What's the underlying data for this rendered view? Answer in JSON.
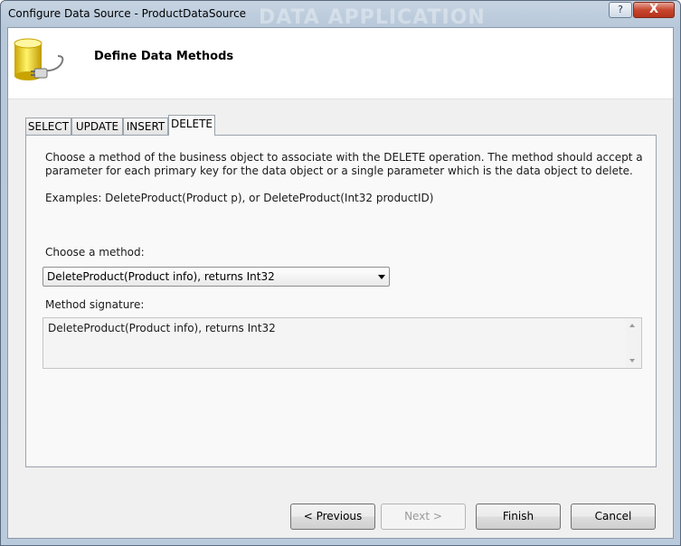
{
  "window": {
    "title": "Configure Data Source - ProductDataSource",
    "watermark": "DATA APPLICATION",
    "help_label": "?",
    "close_label": "X"
  },
  "header": {
    "title": "Define Data Methods",
    "icon": "database-plug-icon"
  },
  "tabs": [
    {
      "label": "SELECT",
      "active": false
    },
    {
      "label": "UPDATE",
      "active": false
    },
    {
      "label": "INSERT",
      "active": false
    },
    {
      "label": "DELETE",
      "active": true
    }
  ],
  "panel": {
    "description": "Choose a method of the business object to associate with the DELETE operation. The method should accept a parameter for each primary key for the data object or a single parameter which is the data object to delete.",
    "examples": "Examples: DeleteProduct(Product p), or DeleteProduct(Int32 productID)",
    "method_label": "Choose a method:",
    "method_value": "DeleteProduct(Product info), returns Int32",
    "signature_label": "Method signature:",
    "signature_value": "DeleteProduct(Product info), returns Int32"
  },
  "buttons": {
    "previous": "< Previous",
    "next": "Next >",
    "finish": "Finish",
    "cancel": "Cancel"
  },
  "colors": {
    "title_gradient": "#b9cadc",
    "client_bg": "#f0f0f0",
    "header_bg": "#ffffff",
    "close_red": "#c7462f"
  }
}
